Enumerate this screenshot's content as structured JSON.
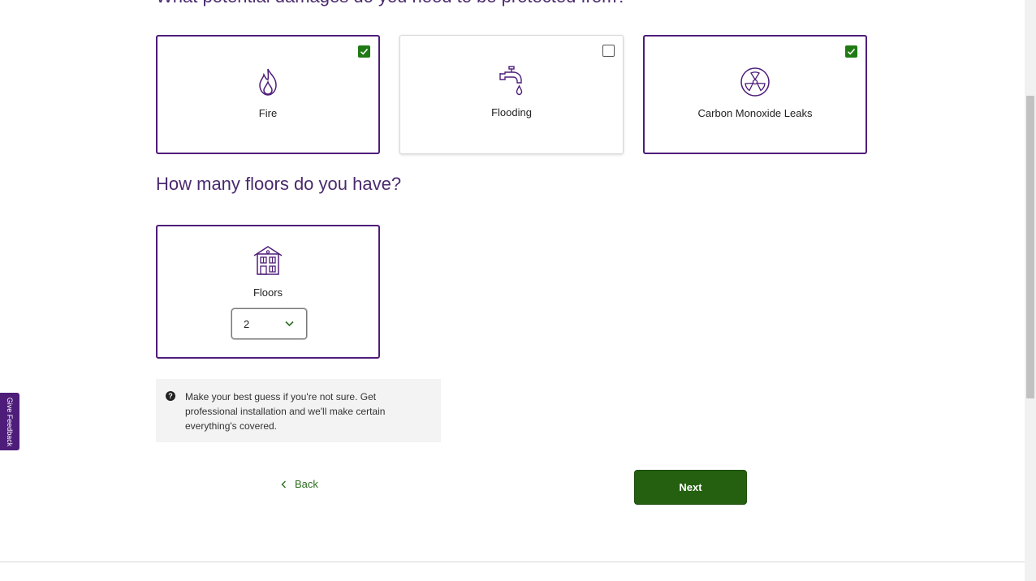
{
  "question_damages": "What potential damages do you need to be protected from?",
  "damage_options": [
    {
      "label": "Fire",
      "icon": "fire-icon",
      "checked": true
    },
    {
      "label": "Flooding",
      "icon": "faucet-icon",
      "checked": false
    },
    {
      "label": "Carbon Monoxide Leaks",
      "icon": "radiation-icon",
      "checked": true
    }
  ],
  "question_floors": "How many floors do you have?",
  "floors": {
    "label": "Floors",
    "icon": "house-icon",
    "selected_value": "2"
  },
  "hint": {
    "icon": "question-circle-icon",
    "text": "Make your best guess if you're not sure. Get professional installation and we'll make certain everything's covered."
  },
  "nav": {
    "back_label": "Back",
    "next_label": "Next"
  },
  "feedback_tab": "Give Feedback",
  "colors": {
    "accent_purple": "#4e1d7a",
    "check_green": "#1f7a13",
    "button_green": "#24600f"
  }
}
